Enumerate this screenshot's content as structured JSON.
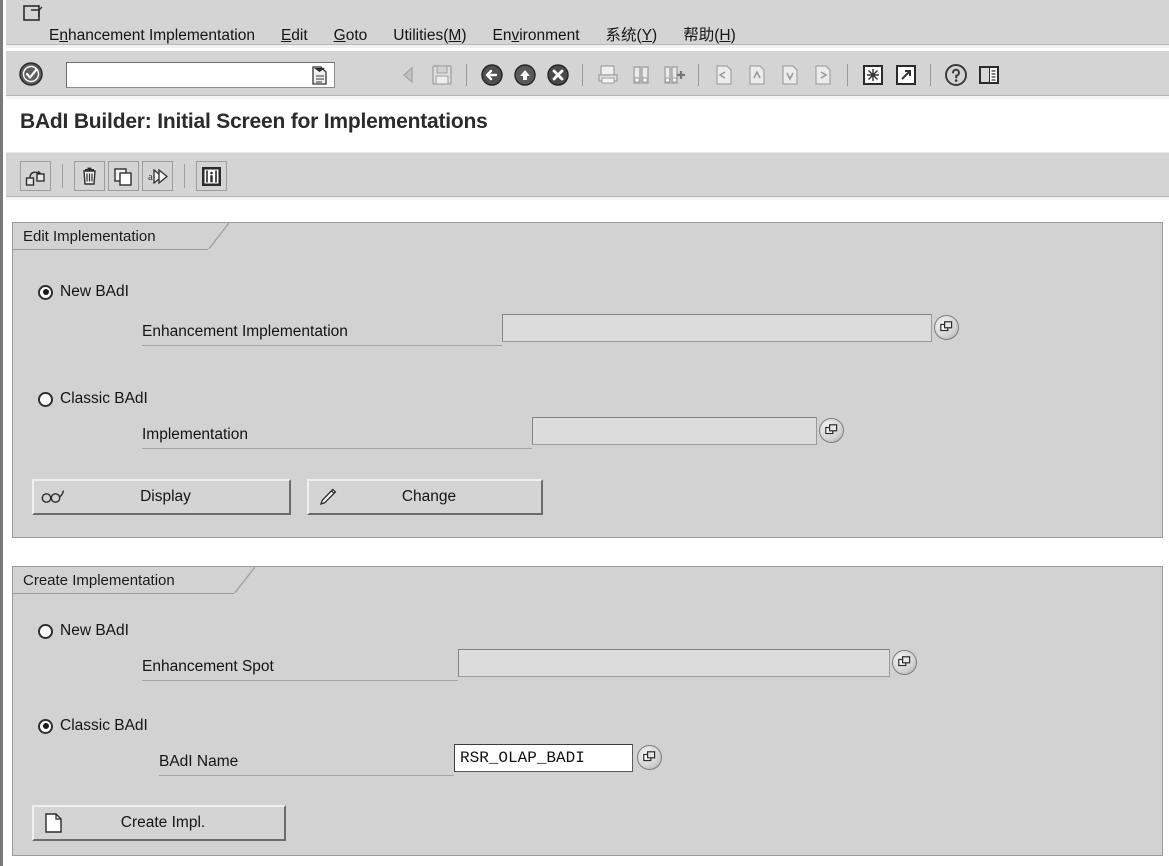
{
  "window": {
    "system_icon": "window-menu-icon"
  },
  "menu": {
    "items": [
      {
        "label": "Enhancement Implementation",
        "accel": "n",
        "name": "menu-enhancement-implementation"
      },
      {
        "label": "Edit",
        "accel": "E",
        "name": "menu-edit"
      },
      {
        "label": "Goto",
        "accel": "G",
        "name": "menu-goto"
      },
      {
        "label": "Utilities(M)",
        "accel": "M",
        "name": "menu-utilities"
      },
      {
        "label": "Environment",
        "accel": "v",
        "name": "menu-environment"
      },
      {
        "label": "系统(Y)",
        "accel": "Y",
        "name": "menu-system"
      },
      {
        "label": "帮助(H)",
        "accel": "H",
        "name": "menu-help"
      }
    ]
  },
  "toolbar": {
    "ok_icon": "enter-check-icon",
    "command_field": {
      "value": "",
      "placeholder": "",
      "dropdown_icon": "command-history-icon"
    },
    "buttons": [
      {
        "icon": "back-arrow-icon",
        "name": "tb-back-disabled"
      },
      {
        "icon": "save-icon",
        "name": "tb-save"
      },
      {
        "icon": "green-back-icon",
        "name": "tb-back"
      },
      {
        "icon": "yellow-up-icon",
        "name": "tb-exit"
      },
      {
        "icon": "red-cancel-icon",
        "name": "tb-cancel"
      },
      {
        "icon": "print-icon",
        "name": "tb-print"
      },
      {
        "icon": "find-icon",
        "name": "tb-find"
      },
      {
        "icon": "find-next-icon",
        "name": "tb-find-next"
      },
      {
        "icon": "first-page-icon",
        "name": "tb-first-page"
      },
      {
        "icon": "prev-page-icon",
        "name": "tb-prev-page"
      },
      {
        "icon": "next-page-icon",
        "name": "tb-next-page"
      },
      {
        "icon": "last-page-icon",
        "name": "tb-last-page"
      },
      {
        "icon": "new-session-icon",
        "name": "tb-new-session"
      },
      {
        "icon": "shortcut-icon",
        "name": "tb-create-shortcut"
      },
      {
        "icon": "help-icon",
        "name": "tb-help"
      },
      {
        "icon": "layout-menu-icon",
        "name": "tb-layout-menu"
      }
    ]
  },
  "title": "BAdI Builder: Initial Screen for Implementations",
  "app_toolbar": {
    "buttons": [
      {
        "icon": "transport-organizer-icon",
        "name": "app-transport"
      },
      {
        "icon": "trash-delete-icon",
        "name": "app-delete"
      },
      {
        "icon": "copy-icon",
        "name": "app-copy"
      },
      {
        "icon": "rename-icon",
        "name": "app-rename"
      },
      {
        "icon": "info-icon",
        "name": "app-info"
      }
    ]
  },
  "edit_section": {
    "title": "Edit Implementation",
    "new_badi": {
      "label": "New BAdI",
      "selected": true
    },
    "enhancement_implementation": {
      "label": "Enhancement Implementation",
      "value": "",
      "enabled": false,
      "f4_icon": "value-help-icon"
    },
    "classic_badi": {
      "label": "Classic BAdI",
      "selected": false
    },
    "implementation": {
      "label": "Implementation",
      "value": "",
      "enabled": false,
      "f4_icon": "value-help-icon"
    },
    "display_button": {
      "label": "Display",
      "icon": "glasses-display-icon"
    },
    "change_button": {
      "label": "Change",
      "icon": "pencil-change-icon"
    }
  },
  "create_section": {
    "title": "Create Implementation",
    "new_badi": {
      "label": "New BAdI",
      "selected": false
    },
    "enhancement_spot": {
      "label": "Enhancement Spot",
      "value": "",
      "enabled": false,
      "f4_icon": "value-help-icon"
    },
    "classic_badi": {
      "label": "Classic BAdI",
      "selected": true
    },
    "badi_name": {
      "label": "BAdI Name",
      "value": "RSR_OLAP_BADI",
      "enabled": true,
      "f4_icon": "value-help-icon"
    },
    "create_button": {
      "label": "Create Impl.",
      "icon": "new-document-icon"
    }
  },
  "colors": {
    "chrome": "#d4d4d4",
    "panel": "#d2d2d2",
    "panel_border": "#9b9b9b",
    "field_disabled": "#dcdcdc",
    "field_active": "#ffffff",
    "text": "#141414"
  }
}
